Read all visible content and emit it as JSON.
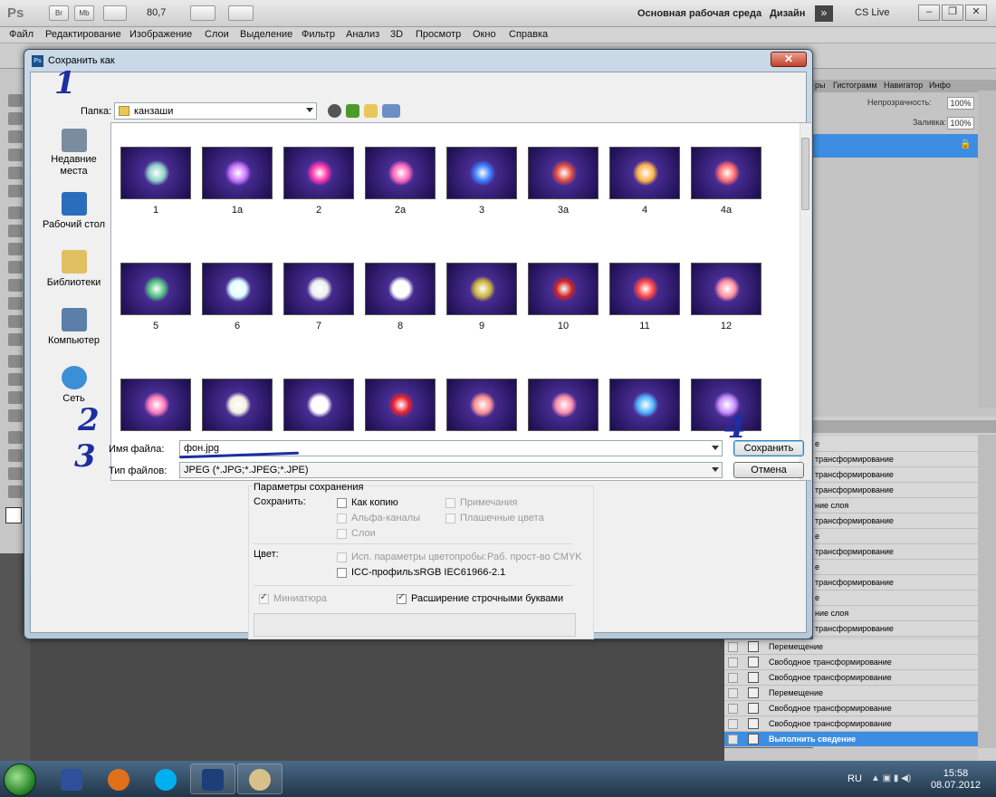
{
  "app": {
    "logo": "Ps",
    "bar_buttons": [
      "Br",
      "Mb"
    ],
    "zoom": "80,7",
    "workspace": "Основная рабочая среда",
    "design": "Дизайн",
    "cs_live": "CS Live",
    "win_controls": [
      "–",
      "❐",
      "✕"
    ]
  },
  "menu": [
    "Файл",
    "Редактирование",
    "Изображение",
    "Слои",
    "Выделение",
    "Фильтр",
    "Анализ",
    "3D",
    "Просмотр",
    "Окно",
    "Справка"
  ],
  "right_panel": {
    "tabs": [
      "ры",
      "Гистограмм",
      "Навигатор",
      "Инфо"
    ],
    "opacity_label": "Непрозрачность:",
    "opacity_value": "100%",
    "fill_label": "Заливка:",
    "fill_value": "100%"
  },
  "history": {
    "partial_rows": [
      "е",
      "трансформирование",
      "трансформирование",
      "трансформирование",
      "ние слоя",
      "трансформирование",
      "е",
      "трансформирование",
      "е",
      "трансформирование",
      "е",
      "ние слоя",
      "трансформирование"
    ],
    "rows": [
      {
        "label": "Перемещение"
      },
      {
        "label": "Свободное трансформирование"
      },
      {
        "label": "Свободное трансформирование"
      },
      {
        "label": "Перемещение"
      },
      {
        "label": "Свободное трансформирование"
      },
      {
        "label": "Свободное трансформирование"
      },
      {
        "label": "Выполнить сведение"
      }
    ]
  },
  "dialog": {
    "title": "Сохранить как",
    "folder_label": "Папка:",
    "folder_value": "канзаши",
    "places": [
      "Недавние места",
      "Рабочий стол",
      "Библиотеки",
      "Компьютер",
      "Сеть"
    ],
    "files": [
      "1",
      "1а",
      "2",
      "2а",
      "3",
      "3а",
      "4",
      "4а",
      "5",
      "6",
      "7",
      "8",
      "9",
      "10",
      "11",
      "12",
      "",
      "",
      "",
      "",
      "",
      "",
      "",
      ""
    ],
    "filename_label": "Имя файла:",
    "filename_value": "фон.jpg",
    "filetype_label": "Тип файлов:",
    "filetype_value": "JPEG (*.JPG;*.JPEG;*.JPE)",
    "save_button": "Сохранить",
    "cancel_button": "Отмена",
    "options": {
      "group_title": "Параметры сохранения",
      "save_label": "Сохранить:",
      "as_copy": "Как копию",
      "notes": "Примечания",
      "alpha": "Альфа-каналы",
      "spot": "Плашечные цвета",
      "layers": "Слои",
      "color_label": "Цвет:",
      "proof": "Исп. параметры цветопробы:",
      "proof_value": "Раб. прост-во CMYK",
      "icc": "ICC-профиль:",
      "icc_value": "sRGB IEC61966-2.1",
      "thumbnail": "Миниатюра",
      "lowercase": "Расширение строчными буквами"
    }
  },
  "annotations": [
    "1",
    "2",
    "3",
    "4"
  ],
  "taskbar": {
    "lang": "RU",
    "time": "15:58",
    "date": "08.07.2012"
  },
  "colors": {
    "accent": "#3d8ee3",
    "annotation": "#1d2fa0",
    "thumb_bg": "#3a1f7a"
  }
}
